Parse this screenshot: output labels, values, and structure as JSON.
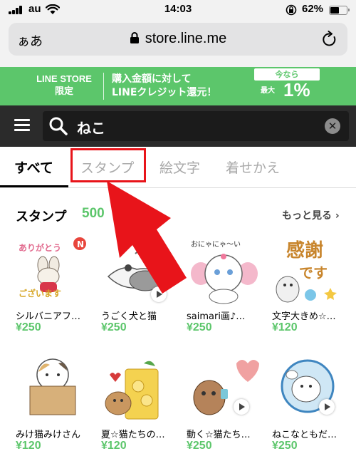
{
  "status_bar": {
    "carrier": "au",
    "time": "14:03",
    "battery_percent": "62%",
    "battery_level": 0.62
  },
  "browser": {
    "aa_label": "ぁあ",
    "url": "store.line.me"
  },
  "banner": {
    "brand_line1": "LINE STORE",
    "brand_line2": "限定",
    "promo_line1": "購入金額に対して",
    "promo_line2": "LINEクレジット還元！",
    "badge_label": "今なら",
    "max_label": "最大",
    "rate": "1%"
  },
  "search": {
    "query": "ねこ"
  },
  "tabs": [
    {
      "label": "すべて",
      "active": true
    },
    {
      "label": "スタンプ",
      "active": false
    },
    {
      "label": "絵文字",
      "active": false
    },
    {
      "label": "着せかえ",
      "active": false
    }
  ],
  "section": {
    "title": "スタンプ",
    "count": "500",
    "more_label": "もっと見る ›"
  },
  "items": [
    {
      "name": "シルバニアフ…",
      "price": "¥250",
      "badge": "N",
      "thumb_text_1": "ありがとう",
      "thumb_text_2": "ございます"
    },
    {
      "name": "うごく犬と猫",
      "price": "¥250"
    },
    {
      "name": "saimari画♪…",
      "price": "¥250",
      "thumb_text": "おにゃにゃ〜い"
    },
    {
      "name": "文字大きめ☆…",
      "price": "¥120",
      "thumb_text_1": "感謝",
      "thumb_text_2": "です"
    },
    {
      "name": "みけ猫みけさん",
      "price": "¥120"
    },
    {
      "name": "夏☆猫たちの…",
      "price": "¥120"
    },
    {
      "name": "動く☆猫たち…",
      "price": "¥250"
    },
    {
      "name": "ねこなともだ…",
      "price": "¥250"
    }
  ],
  "colors": {
    "brand_green": "#5cc66b",
    "highlight_red": "#e8141a",
    "search_bg": "#2b2b2b"
  },
  "icons": [
    "signal-icon",
    "wifi-icon",
    "rotation-lock-icon",
    "battery-icon",
    "lock-icon",
    "reload-icon",
    "menu-icon",
    "search-icon",
    "clear-icon",
    "play-icon",
    "arrow-annotation"
  ]
}
